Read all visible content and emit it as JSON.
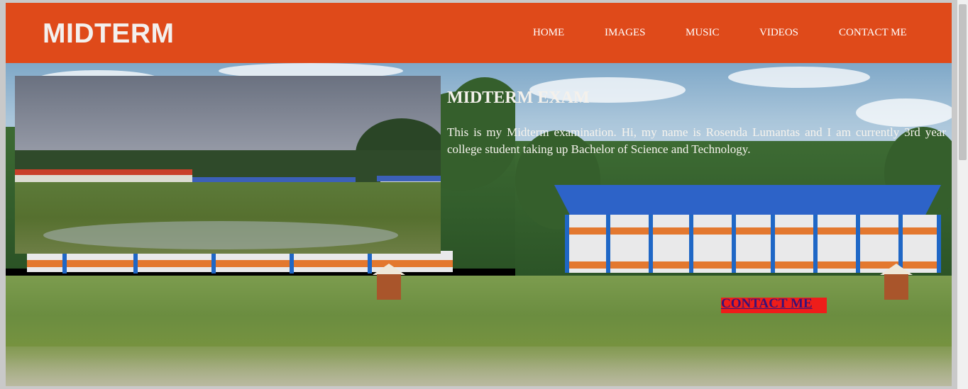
{
  "site": {
    "logo": "MIDTERM"
  },
  "nav": {
    "items": [
      {
        "label": "HOME"
      },
      {
        "label": "IMAGES"
      },
      {
        "label": "MUSIC"
      },
      {
        "label": "VIDEOS"
      },
      {
        "label": "CONTACT ME"
      }
    ]
  },
  "content": {
    "title": "MIDTERM EXAM",
    "intro": "This is my Midterm examination. Hi, my name is Rosenda Lumantas and I am currently 3rd year college student taking up Bachelor of Science and Technology.",
    "cta_label": "CONTACT ME"
  },
  "colors": {
    "header": "#df4a1a",
    "cta_background": "#ee1d1a",
    "cta_text": "#3a1278"
  }
}
